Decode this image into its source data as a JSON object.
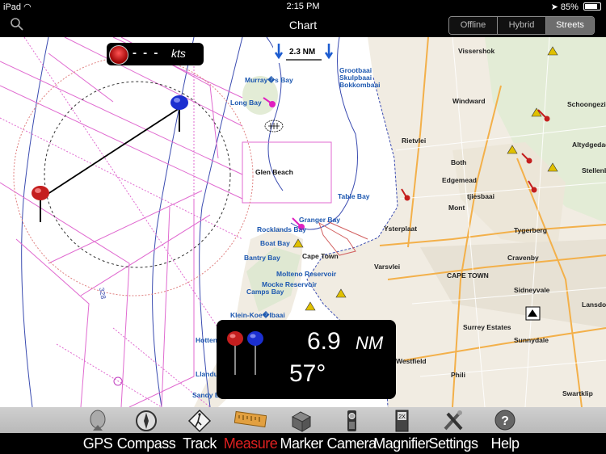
{
  "status": {
    "device": "iPad",
    "time": "2:15 PM",
    "battery": "85%",
    "battery_level": 0.85
  },
  "nav": {
    "title": "Chart",
    "map_modes": [
      {
        "label": "Offline",
        "active": false
      },
      {
        "label": "Hybrid",
        "active": false
      },
      {
        "label": "Streets",
        "active": true
      }
    ]
  },
  "speed": {
    "value": "- - -",
    "unit": "kts"
  },
  "scale": {
    "label": "2.3 NM"
  },
  "measure": {
    "distance": "6.9",
    "distance_unit": "NM",
    "bearing": "57°"
  },
  "map_labels": {
    "water": [
      "Murray�s Bay",
      "Long Bay",
      "Glen Beach",
      "Table Bay",
      "Rocklands Bay",
      "Granger Bay",
      "Boat Bay",
      "Bantry Bay",
      "Molteno Reservoir",
      "Mocke Reservoir",
      "Camps Bay",
      "Klein-Koe�lbaai",
      "Hottentots",
      "Llandudno",
      "Sandy Bay",
      "Grootbaai",
      "Skulpbaai",
      "Bokkombaai"
    ],
    "land": [
      "Vissershok",
      "Windward",
      "Schoongezicht",
      "Rietvlei",
      "Altydgedacht",
      "Both",
      "Edgemead",
      "Stellenberg",
      "tjiesbaai",
      "Mont",
      "Ysterplaat",
      "Tygerberg",
      "Cape Town",
      "Varsvlei",
      "CAPE TOWN",
      "Cravenby",
      "Sidneyvale",
      "Surrey Estates",
      "Sunnydale",
      "Phili",
      "Swartklip",
      "Lansdowne",
      "Westfield"
    ],
    "contour": "328"
  },
  "toolbar": [
    {
      "label": "GPS",
      "icon": "gps-dish-icon",
      "active": false
    },
    {
      "label": "Compass",
      "icon": "compass-icon",
      "active": false
    },
    {
      "label": "Track",
      "icon": "track-icon",
      "active": false
    },
    {
      "label": "Measure",
      "icon": "ruler-icon",
      "active": true
    },
    {
      "label": "Marker",
      "icon": "marker-icon",
      "active": false
    },
    {
      "label": "Camera",
      "icon": "camera-icon",
      "active": false
    },
    {
      "label": "Magnifier",
      "icon": "magnifier-icon",
      "active": false
    },
    {
      "label": "Settings",
      "icon": "settings-tools-icon",
      "active": false
    },
    {
      "label": "Help",
      "icon": "help-icon",
      "active": false
    }
  ],
  "colors": {
    "water_label": "#1d58b0",
    "route_lines": "#e06ad0",
    "active_tool": "#e02020",
    "pin_red": "#c41e1e",
    "pin_blue": "#1b2fd0"
  }
}
